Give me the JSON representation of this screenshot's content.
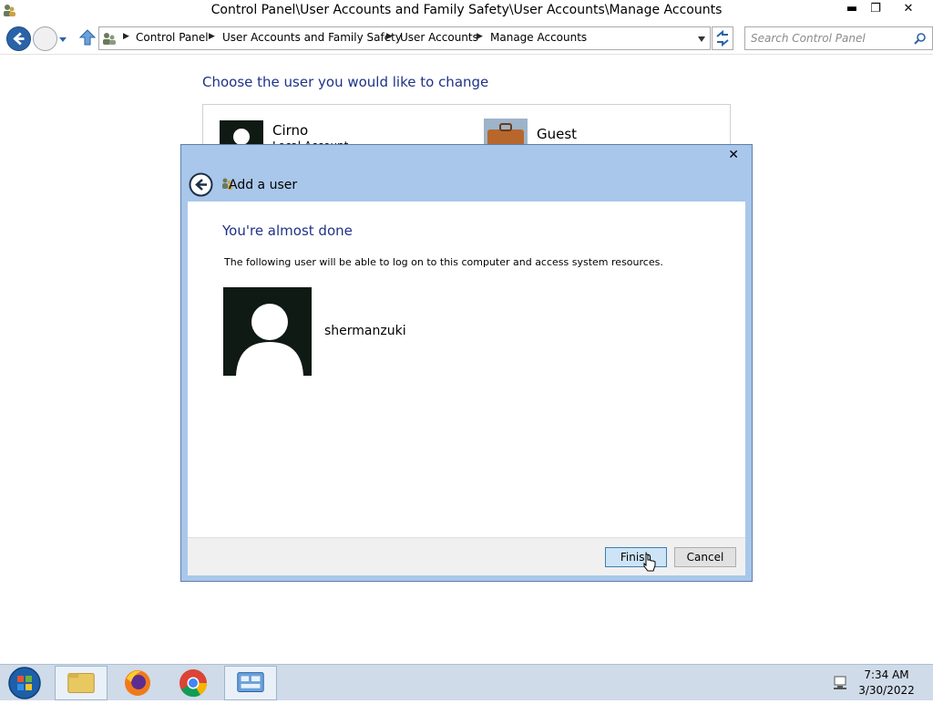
{
  "window": {
    "title": "Control Panel\\User Accounts and Family Safety\\User Accounts\\Manage Accounts",
    "controls": {
      "minimize": "▬",
      "maximize": "❐",
      "close": "✕"
    }
  },
  "address_bar": {
    "breadcrumbs": [
      "Control Panel",
      "User Accounts and Family Safety",
      "User Accounts",
      "Manage Accounts"
    ]
  },
  "search": {
    "placeholder": "Search Control Panel"
  },
  "main": {
    "heading": "Choose the user you would like to change",
    "accounts": [
      {
        "name": "Cirno",
        "type": "Local Account"
      },
      {
        "name": "Guest"
      }
    ]
  },
  "dialog": {
    "title": "Add a user",
    "close": "✕",
    "heading": "You're almost done",
    "description": "The following user will be able to log on to this computer and access system resources.",
    "new_user": "shermanzuki",
    "buttons": {
      "finish": "Finish",
      "cancel": "Cancel"
    }
  },
  "taskbar": {
    "apps": [
      "start-orb",
      "file-explorer",
      "firefox",
      "chrome",
      "control-panel"
    ],
    "clock": {
      "time": "7:34 AM",
      "date": "3/30/2022"
    }
  },
  "colors": {
    "heading": "#1e3287",
    "dialog_frame": "#a9c7ea",
    "taskbar": "#cfdbe8",
    "back_button": "#2b63a8"
  }
}
